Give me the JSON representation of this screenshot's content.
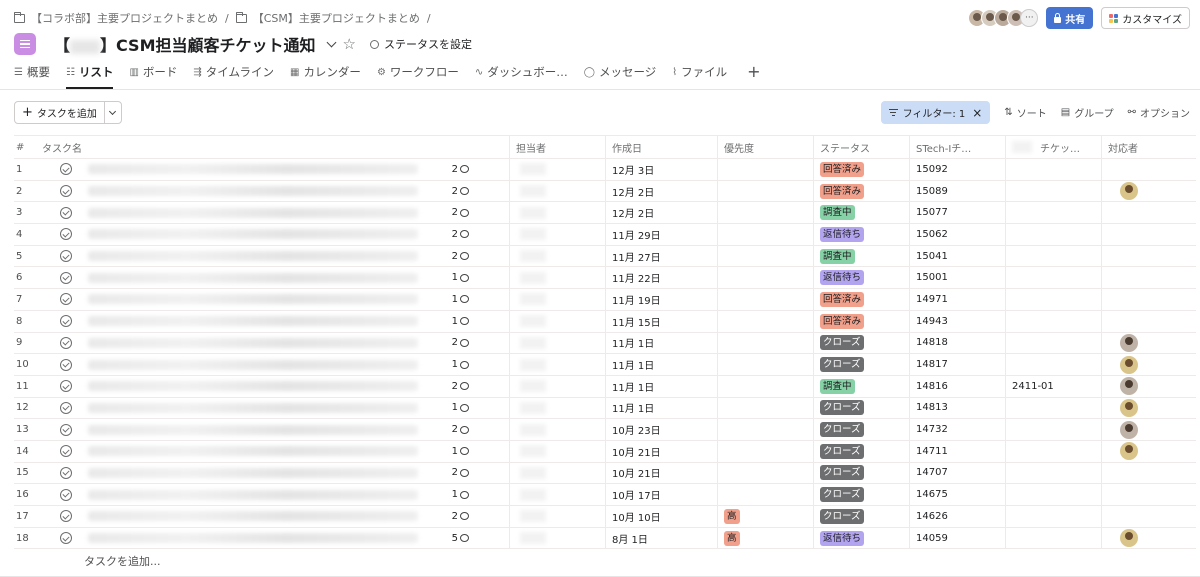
{
  "breadcrumb": {
    "items": [
      "【コラボ部】主要プロジェクトまとめ",
      "【CSM】主要プロジェクトまとめ"
    ],
    "separator": "/"
  },
  "header": {
    "title_prefix": "【",
    "title_suffix": "】CSM担当顧客チケット通知",
    "status_label": "ステータスを設定",
    "share_label": "共有",
    "customize_label": "カスタマイズ",
    "more_members": "···"
  },
  "tabs": [
    {
      "label": "概要",
      "icon": "overview-icon",
      "glyph": "☰"
    },
    {
      "label": "リスト",
      "icon": "list-icon",
      "glyph": "☷"
    },
    {
      "label": "ボード",
      "icon": "board-icon",
      "glyph": "▥"
    },
    {
      "label": "タイムライン",
      "icon": "timeline-icon",
      "glyph": "⇶"
    },
    {
      "label": "カレンダー",
      "icon": "calendar-icon",
      "glyph": "▦"
    },
    {
      "label": "ワークフロー",
      "icon": "workflow-icon",
      "glyph": "⚙"
    },
    {
      "label": "ダッシュボー…",
      "icon": "dashboard-icon",
      "glyph": "∿"
    },
    {
      "label": "メッセージ",
      "icon": "message-icon",
      "glyph": "◯"
    },
    {
      "label": "ファイル",
      "icon": "file-icon",
      "glyph": "⌇"
    }
  ],
  "active_tab": "リスト",
  "toolbar": {
    "add_task": "タスクを追加",
    "filter": "フィルター: 1",
    "sort": "ソート",
    "group": "グループ",
    "options": "オプション"
  },
  "columns": {
    "num": "#",
    "name": "タスク名",
    "assignee": "担当者",
    "created": "作成日",
    "priority": "優先度",
    "status": "ステータス",
    "stech": "STech-Iチ…",
    "ticket": "チケッ…",
    "responder": "対応者"
  },
  "rows": [
    {
      "num": "1",
      "comments": "2",
      "date": "12月 3日",
      "priority": "",
      "status": "回答済み",
      "stech": "15092",
      "ticket": "",
      "responder": false
    },
    {
      "num": "2",
      "comments": "2",
      "date": "12月 2日",
      "priority": "",
      "status": "回答済み",
      "stech": "15089",
      "ticket": "",
      "responder": true
    },
    {
      "num": "3",
      "comments": "2",
      "date": "12月 2日",
      "priority": "",
      "status": "調査中",
      "stech": "15077",
      "ticket": "",
      "responder": false
    },
    {
      "num": "4",
      "comments": "2",
      "date": "11月 29日",
      "priority": "",
      "status": "返信待ち",
      "stech": "15062",
      "ticket": "",
      "responder": false
    },
    {
      "num": "5",
      "comments": "2",
      "date": "11月 27日",
      "priority": "",
      "status": "調査中",
      "stech": "15041",
      "ticket": "",
      "responder": false
    },
    {
      "num": "6",
      "comments": "1",
      "date": "11月 22日",
      "priority": "",
      "status": "返信待ち",
      "stech": "15001",
      "ticket": "",
      "responder": false
    },
    {
      "num": "7",
      "comments": "1",
      "date": "11月 19日",
      "priority": "",
      "status": "回答済み",
      "stech": "14971",
      "ticket": "",
      "responder": false
    },
    {
      "num": "8",
      "comments": "1",
      "date": "11月 15日",
      "priority": "",
      "status": "回答済み",
      "stech": "14943",
      "ticket": "",
      "responder": false
    },
    {
      "num": "9",
      "comments": "2",
      "date": "11月 1日",
      "priority": "",
      "status": "クローズ",
      "stech": "14818",
      "ticket": "",
      "responder": true
    },
    {
      "num": "10",
      "comments": "1",
      "date": "11月 1日",
      "priority": "",
      "status": "クローズ",
      "stech": "14817",
      "ticket": "",
      "responder": true
    },
    {
      "num": "11",
      "comments": "2",
      "date": "11月 1日",
      "priority": "",
      "status": "調査中",
      "stech": "14816",
      "ticket": "2411-01",
      "responder": true
    },
    {
      "num": "12",
      "comments": "1",
      "date": "11月 1日",
      "priority": "",
      "status": "クローズ",
      "stech": "14813",
      "ticket": "",
      "responder": true
    },
    {
      "num": "13",
      "comments": "2",
      "date": "10月 23日",
      "priority": "",
      "status": "クローズ",
      "stech": "14732",
      "ticket": "",
      "responder": true
    },
    {
      "num": "14",
      "comments": "1",
      "date": "10月 21日",
      "priority": "",
      "status": "クローズ",
      "stech": "14711",
      "ticket": "",
      "responder": true
    },
    {
      "num": "15",
      "comments": "2",
      "date": "10月 21日",
      "priority": "",
      "status": "クローズ",
      "stech": "14707",
      "ticket": "",
      "responder": false
    },
    {
      "num": "16",
      "comments": "1",
      "date": "10月 17日",
      "priority": "",
      "status": "クローズ",
      "stech": "14675",
      "ticket": "",
      "responder": false
    },
    {
      "num": "17",
      "comments": "2",
      "date": "10月 10日",
      "priority": "高",
      "status": "クローズ",
      "stech": "14626",
      "ticket": "",
      "responder": false
    },
    {
      "num": "18",
      "comments": "5",
      "date": "8月 1日",
      "priority": "高",
      "status": "返信待ち",
      "stech": "14059",
      "ticket": "",
      "responder": true
    }
  ],
  "status_colors": {
    "回答済み": "#f1a08c",
    "調査中": "#86d1a6",
    "返信待ち": "#b3a4f0",
    "クローズ": "#6d6e6f"
  },
  "add_task_row": "タスクを追加..."
}
